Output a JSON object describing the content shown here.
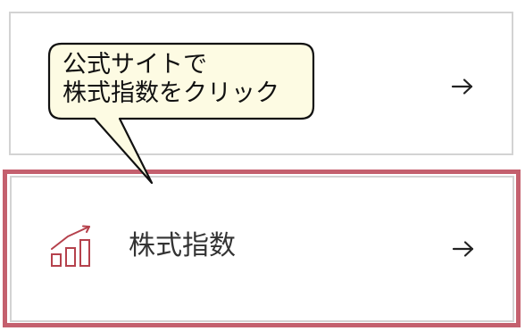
{
  "callout": {
    "line1": "公式サイトで",
    "line2": "株式指数をクリック"
  },
  "list": {
    "index_item": {
      "label": "株式指数",
      "icon": "bar-chart-trend-icon",
      "arrow_icon": "arrow-right-icon"
    },
    "top_item": {
      "arrow_icon": "arrow-right-icon"
    }
  },
  "colors": {
    "highlight": "#c4606e",
    "icon": "#b5414c",
    "callout_fill": "#fdfbe3",
    "card_border": "#d3d3d3"
  }
}
